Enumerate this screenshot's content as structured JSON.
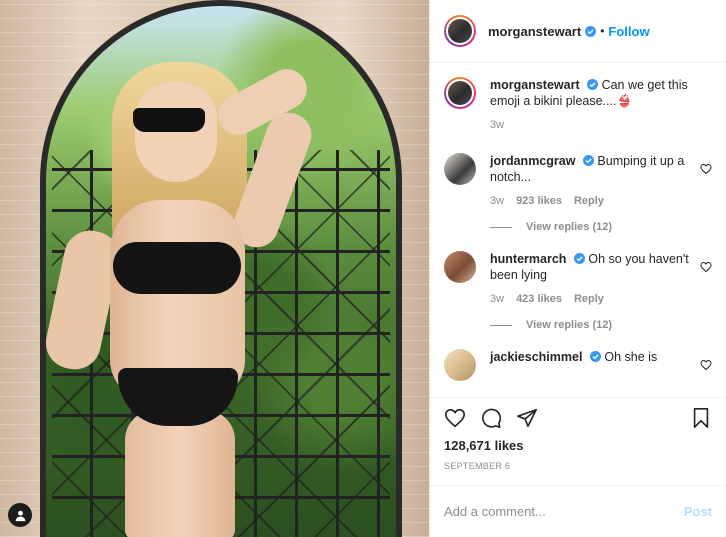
{
  "header": {
    "username": "morganstewart",
    "separator": "•",
    "follow_label": "Follow"
  },
  "caption": {
    "username": "morganstewart",
    "text": "Can we get this emoji a bikini please....👙",
    "time": "3w"
  },
  "comments": [
    {
      "username": "jordanmcgraw",
      "text": "Bumping it up a notch...",
      "time": "3w",
      "likes": "923 likes",
      "reply_label": "Reply",
      "view_replies": "View replies (12)"
    },
    {
      "username": "huntermarch",
      "text": "Oh so you haven't been lying",
      "time": "3w",
      "likes": "423 likes",
      "reply_label": "Reply",
      "view_replies": "View replies (12)"
    },
    {
      "username": "jackieschimmel",
      "text": "Oh she is"
    }
  ],
  "actions": {
    "likes_count": "128,671 likes",
    "date": "SEPTEMBER 6"
  },
  "add_comment": {
    "placeholder": "Add a comment...",
    "post_label": "Post"
  },
  "colors": {
    "accent": "#0095f6",
    "post_disabled": "#b2dffc",
    "muted": "#8e8e8e",
    "text": "#262626"
  }
}
